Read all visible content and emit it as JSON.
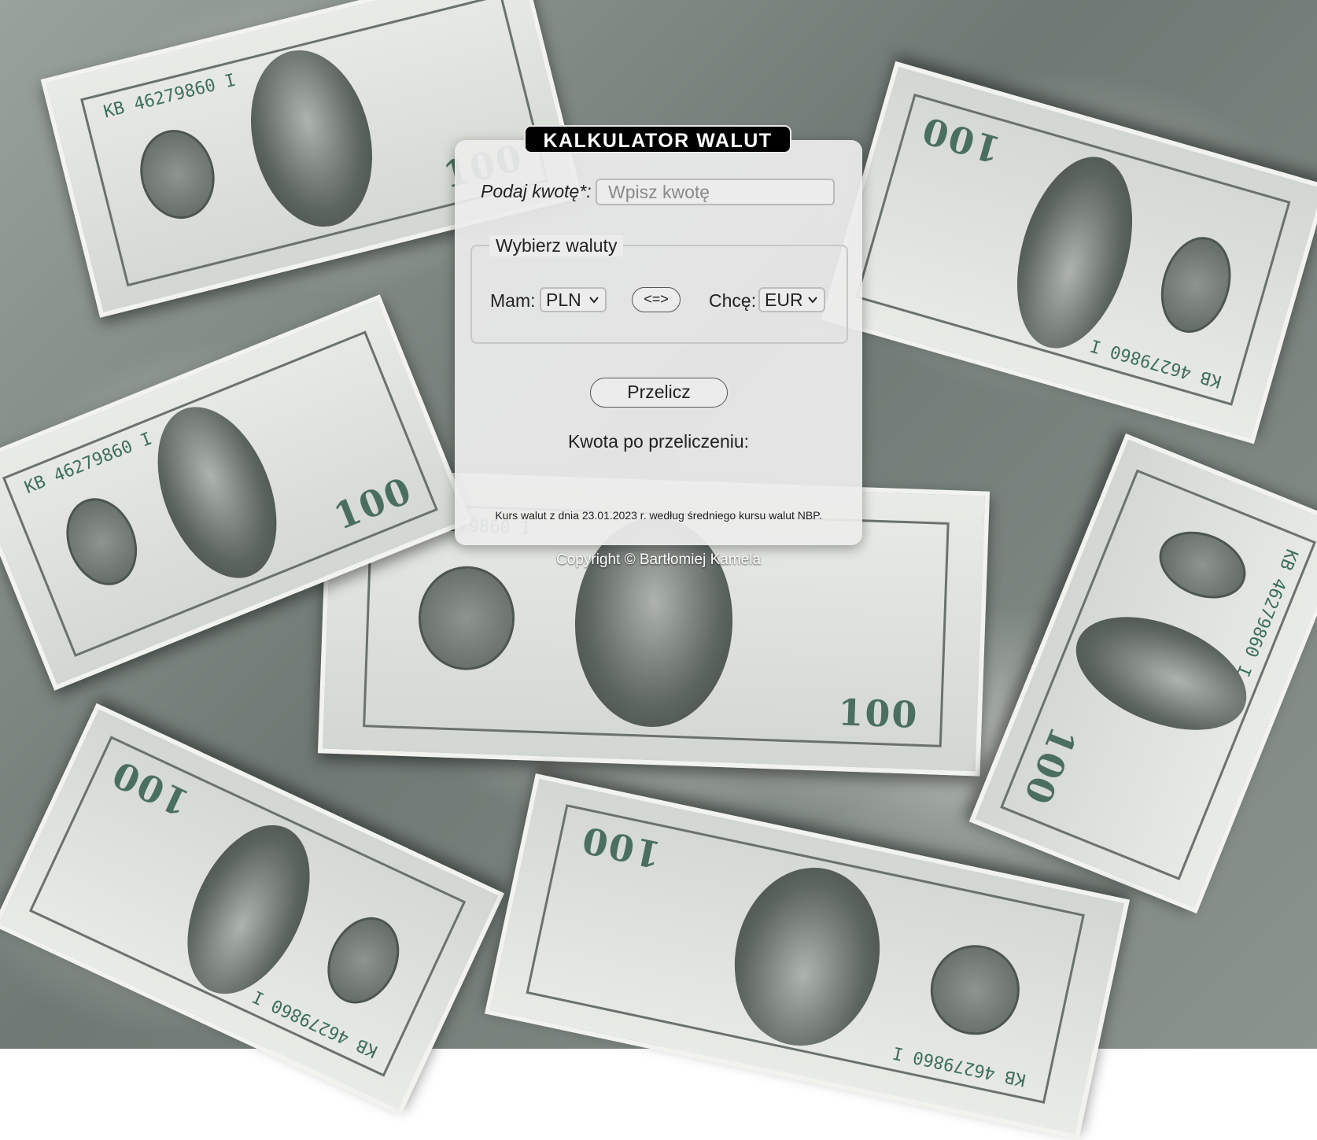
{
  "app": {
    "title": "KALKULATOR WALUT"
  },
  "form": {
    "amount_label": "Podaj kwotę*:",
    "amount_placeholder": "Wpisz kwotę",
    "amount_value": "",
    "currency_legend": "Wybierz waluty",
    "have_label": "Mam:",
    "have_selected": "PLN",
    "swap_label": "<=>",
    "want_label": "Chcę:",
    "want_selected": "EUR",
    "calculate_label": "Przelicz",
    "result_label": "Kwota po przeliczeniu:",
    "rate_note": "Kurs walut z dnia 23.01.2023 r. według średniego kursu walut NBP."
  },
  "footer": {
    "copyright": "Copyright © Bartłomiej Kamela"
  },
  "background": {
    "image": "banknotes-100-usd",
    "serial": "KB 46279860 I",
    "denomination": "100"
  }
}
